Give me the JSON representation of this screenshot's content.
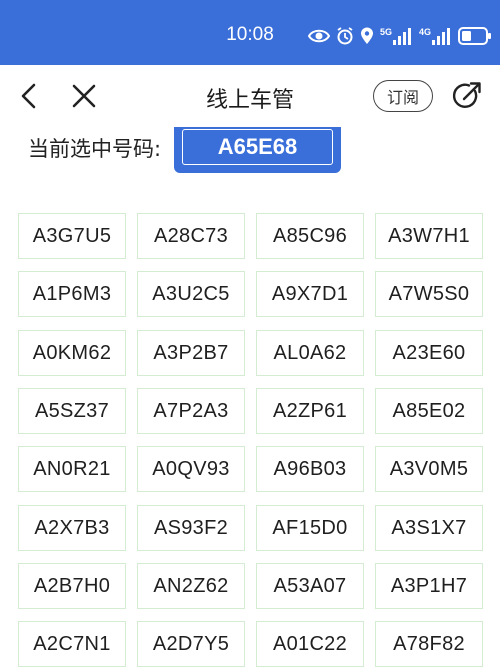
{
  "status_bar": {
    "time": "10:08",
    "icons": [
      "eye-icon",
      "alarm-icon",
      "location-icon",
      "5g-signal-icon",
      "4g-signal-icon",
      "battery-icon"
    ],
    "network_5g": "5G",
    "network_4g": "4G",
    "color": "#3a6fd9"
  },
  "nav": {
    "title": "线上车管",
    "subscribe_label": "订阅"
  },
  "current": {
    "label": "当前选中号码:",
    "plate": "A65E68"
  },
  "plates": [
    [
      "A3G7U5",
      "A28C73",
      "A85C96",
      "A3W7H1"
    ],
    [
      "A1P6M3",
      "A3U2C5",
      "A9X7D1",
      "A7W5S0"
    ],
    [
      "A0KM62",
      "A3P2B7",
      "AL0A62",
      "A23E60"
    ],
    [
      "A5SZ37",
      "A7P2A3",
      "A2ZP61",
      "A85E02"
    ],
    [
      "AN0R21",
      "A0QV93",
      "A96B03",
      "A3V0M5"
    ],
    [
      "A2X7B3",
      "AS93F2",
      "AF15D0",
      "A3S1X7"
    ],
    [
      "A2B7H0",
      "AN2Z62",
      "A53A07",
      "A3P1H7"
    ],
    [
      "A2C7N1",
      "A2D7Y5",
      "A01C22",
      "A78F82"
    ]
  ]
}
